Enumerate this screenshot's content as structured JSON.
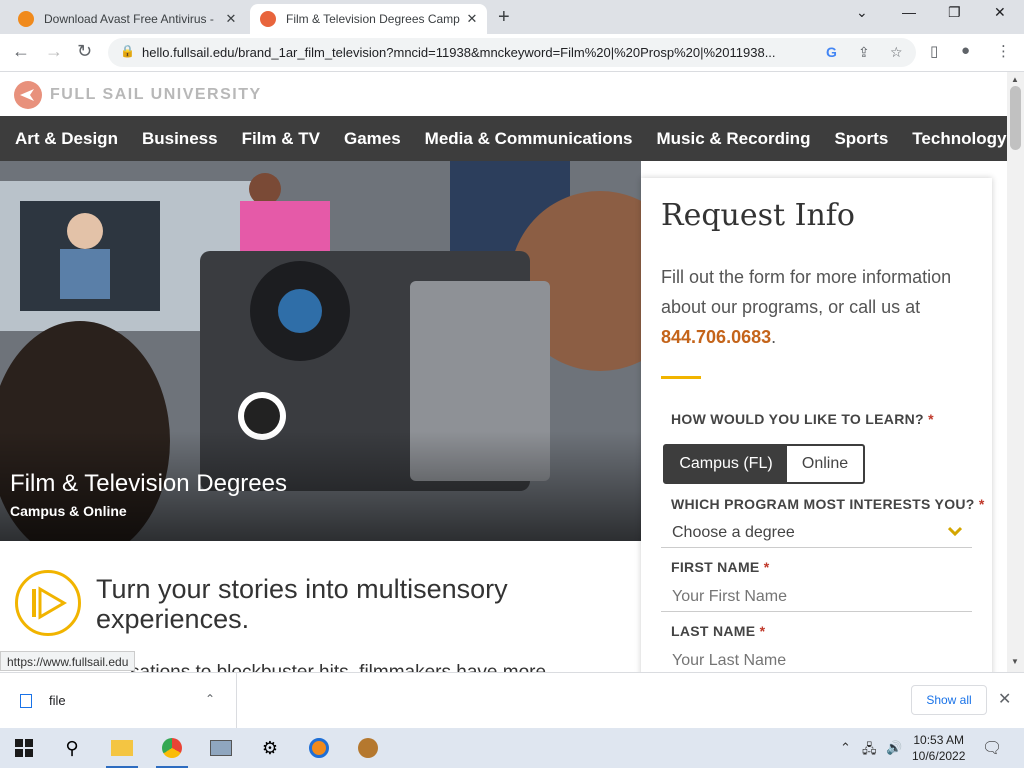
{
  "browser": {
    "tabs": [
      {
        "title": "Download Avast Free Antivirus - ",
        "close": "✕",
        "favicon_color": "#f08a1c"
      },
      {
        "title": "Film & Television Degrees Camp",
        "close": "✕",
        "favicon_color": "#e8643c"
      }
    ],
    "new_tab": "+",
    "url": "hello.fullsail.edu/brand_1ar_film_television?mncid=11938&mnckeyword=Film%20|%20Prosp%20|%2011938...",
    "window_controls": {
      "minimize": "—",
      "restore": "❐",
      "close": "✕",
      "tab_menu": "⌄"
    }
  },
  "site": {
    "logo_text": "FULL SAIL UNIVERSITY",
    "nav": [
      "Art & Design",
      "Business",
      "Film & TV",
      "Games",
      "Media & Communications",
      "Music & Recording",
      "Sports",
      "Technology"
    ],
    "hero": {
      "title": "Film & Television Degrees",
      "subtitle": "Campus & Online"
    },
    "tagline": "Turn your stories into multisensory experiences.",
    "body_peek": "sations to blockbuster hits, filmmakers have more"
  },
  "form": {
    "heading": "Request Info",
    "intro_prefix": "Fill out the form for more information about our programs, or call us at ",
    "phone": "844.706.0683",
    "intro_suffix": ".",
    "learn_label": "HOW WOULD YOU LIKE TO LEARN?",
    "required": "*",
    "learn_options": {
      "selected": "Campus (FL)",
      "other": "Online"
    },
    "program_label": "WHICH PROGRAM MOST INTERESTS YOU?",
    "program_value": "Choose a degree",
    "first_name_label": "FIRST NAME",
    "first_name_placeholder": "Your First Name",
    "last_name_label": "LAST NAME",
    "last_name_placeholder": "Your Last Name"
  },
  "status_url": "https://www.fullsail.edu",
  "downloads": {
    "file_name": "file",
    "show_all": "Show all"
  },
  "taskbar": {
    "time": "10:53 AM",
    "date": "10/6/2022"
  },
  "colors": {
    "nav_bg": "#3d3d3d",
    "accent_gold": "#f1b400",
    "phone": "#c4641a"
  }
}
